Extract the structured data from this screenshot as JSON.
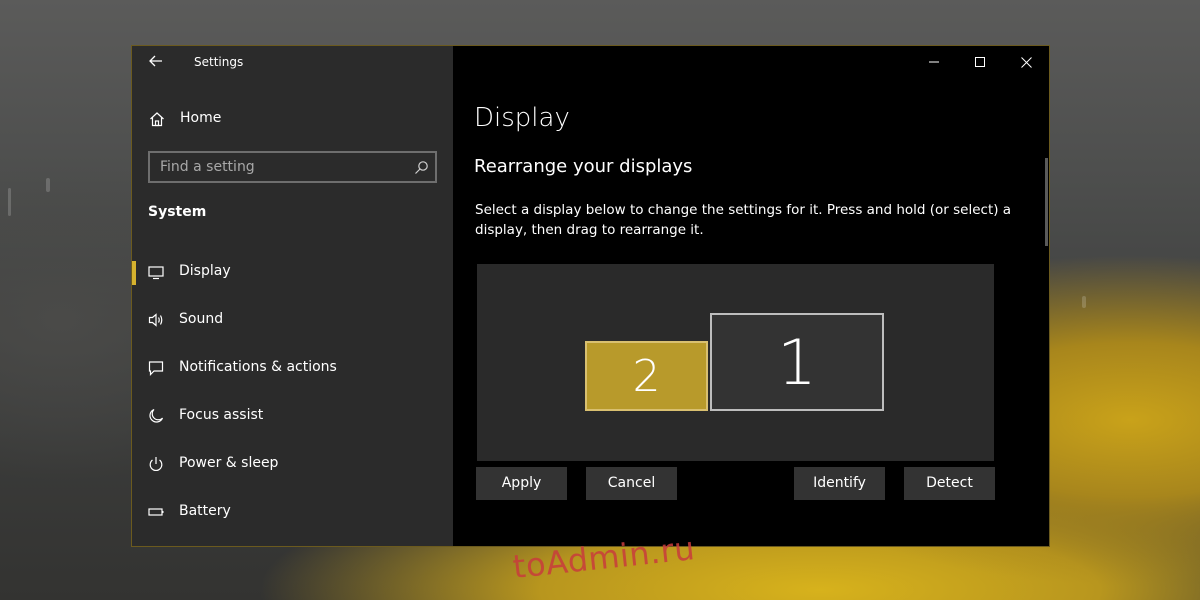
{
  "window": {
    "title": "Settings",
    "accent_color": "#d6b22e"
  },
  "sidebar": {
    "home_label": "Home",
    "search_placeholder": "Find a setting",
    "section_title": "System",
    "items": [
      {
        "label": "Display",
        "icon": "monitor-icon",
        "selected": true
      },
      {
        "label": "Sound",
        "icon": "speaker-icon",
        "selected": false
      },
      {
        "label": "Notifications & actions",
        "icon": "notification-icon",
        "selected": false
      },
      {
        "label": "Focus assist",
        "icon": "moon-icon",
        "selected": false
      },
      {
        "label": "Power & sleep",
        "icon": "power-icon",
        "selected": false
      },
      {
        "label": "Battery",
        "icon": "battery-icon",
        "selected": false
      }
    ]
  },
  "main": {
    "page_title": "Display",
    "section_title": "Rearrange your displays",
    "description": "Select a display below to change the settings for it. Press and hold (or select) a display, then drag to rearrange it.",
    "monitors": [
      {
        "number": "2",
        "selected": true,
        "color": "#b89a2b"
      },
      {
        "number": "1",
        "selected": false,
        "color": "#333333"
      }
    ],
    "buttons": {
      "apply": "Apply",
      "cancel": "Cancel",
      "identify": "Identify",
      "detect": "Detect"
    }
  },
  "watermark": "toAdmin.ru"
}
